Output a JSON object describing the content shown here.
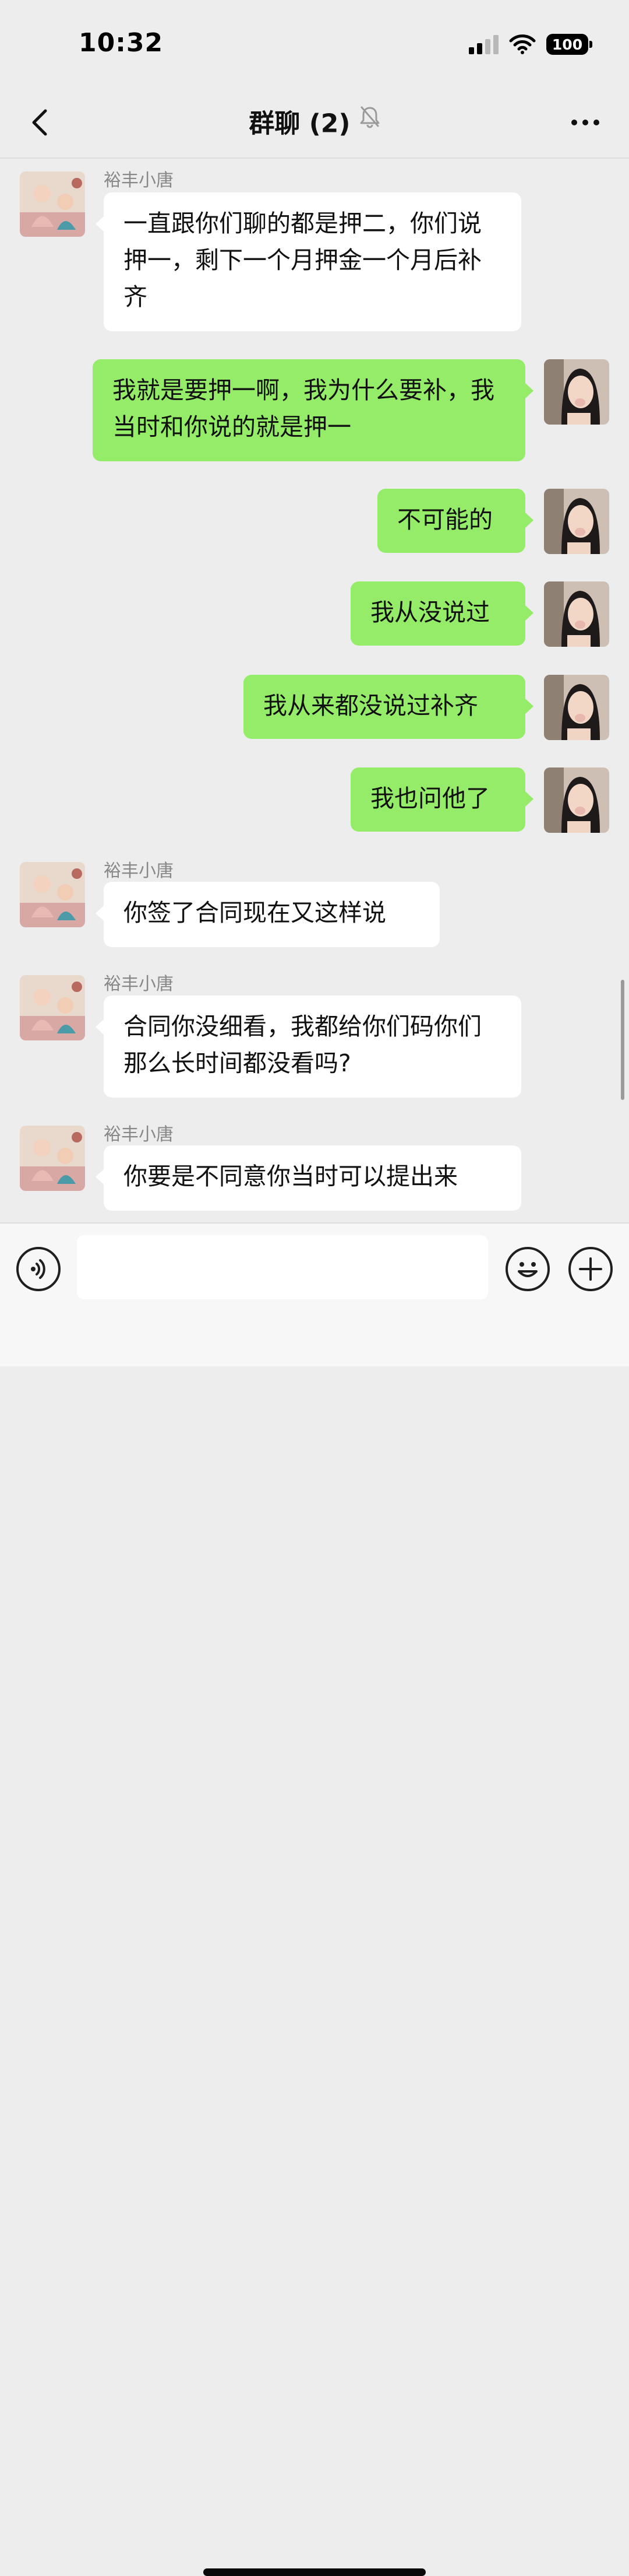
{
  "status_bar": {
    "time": "10:32",
    "battery": "100"
  },
  "nav": {
    "title": "群聊 (2)"
  },
  "messages": [
    {
      "direction": "incoming",
      "sender": "裕丰小唐",
      "text": "一直跟你们聊的都是押二，你们说押一，剩下一个月押金一个月后补齐"
    },
    {
      "direction": "outgoing",
      "text": "我就是要押一啊，我为什么要补，我当时和你说的就是押一"
    },
    {
      "direction": "outgoing",
      "text": "不可能的"
    },
    {
      "direction": "outgoing",
      "text": "我从没说过"
    },
    {
      "direction": "outgoing",
      "text": "我从来都没说过补齐"
    },
    {
      "direction": "outgoing",
      "text": "我也问他了"
    },
    {
      "direction": "incoming",
      "sender": "裕丰小唐",
      "text": "你签了合同现在又这样说"
    },
    {
      "direction": "incoming",
      "sender": "裕丰小唐",
      "text": "合同你没细看，我都给你们码你们那么长时间都没看吗?"
    },
    {
      "direction": "incoming",
      "sender": "裕丰小唐",
      "text": "你要是不同意你当时可以提出来"
    }
  ],
  "input": {
    "value": "",
    "placeholder": ""
  },
  "icons": {
    "back": "chevron-left-icon",
    "mute": "bell-off-icon",
    "more": "more-horizontal-icon",
    "voice": "voice-icon",
    "emoji": "smiley-icon",
    "plus": "plus-circle-icon"
  },
  "colors": {
    "background": "#ededed",
    "outgoing_bubble": "#95ec69",
    "incoming_bubble": "#ffffff",
    "sender_name": "#888888"
  }
}
